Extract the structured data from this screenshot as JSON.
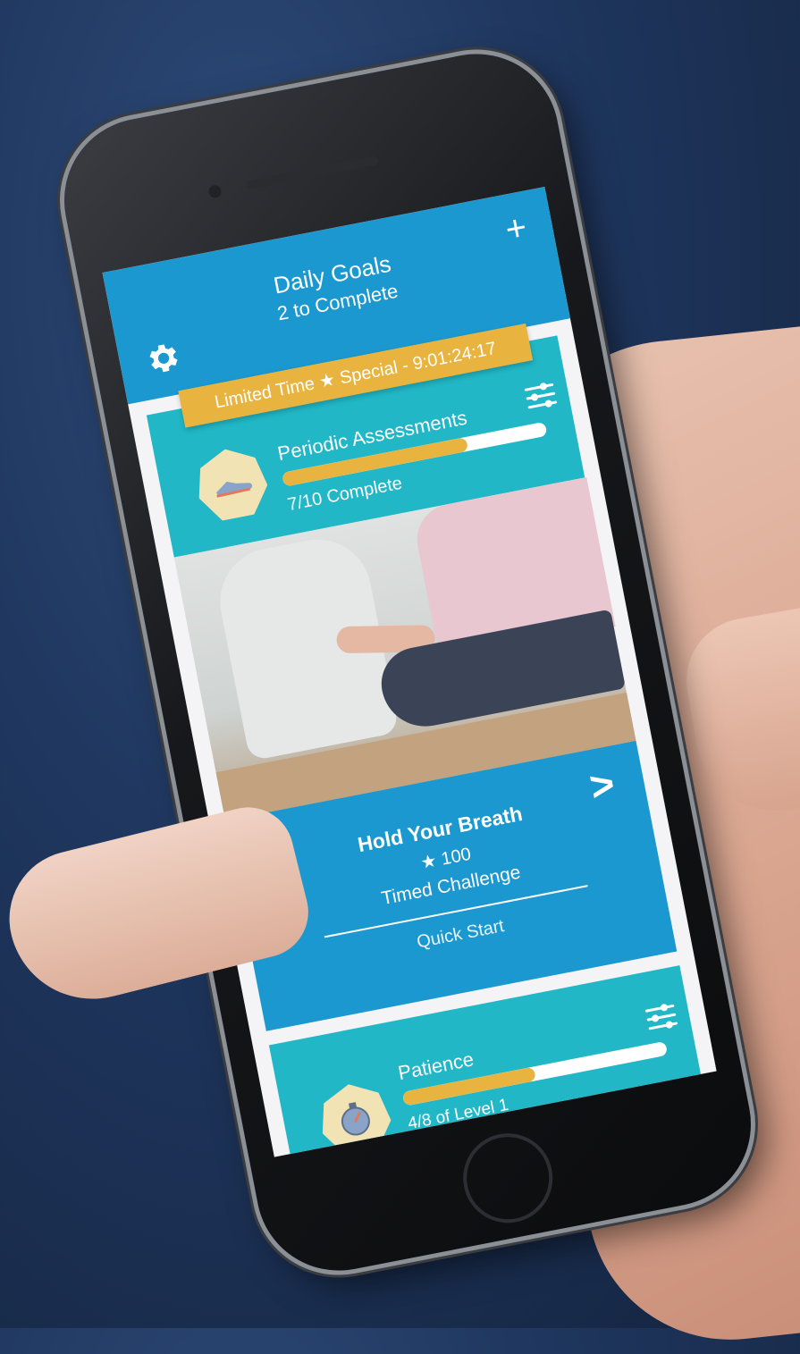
{
  "header": {
    "title": "Daily Goals",
    "subtitle": "2 to Complete",
    "settings_icon": "gear-icon",
    "add_icon": "plus-icon",
    "add_label": "+"
  },
  "promo": {
    "prefix": "Limited Time",
    "star": "★",
    "suffix": "Special - 9:01:24:17"
  },
  "goals": [
    {
      "title": "Periodic Assessments",
      "status": "7/10 Complete",
      "progress": 0.7,
      "icon": "sneaker-icon",
      "settings_icon": "sliders-icon"
    },
    {
      "title": "Patience",
      "status": "4/8 of Level 1",
      "progress": 0.5,
      "icon": "stopwatch-icon",
      "settings_icon": "sliders-icon"
    }
  ],
  "challenge": {
    "title": "Hold Your Breath",
    "points_star": "★",
    "points": "100",
    "type": "Timed Challenge",
    "action": "Quick Start",
    "prev_label": "<",
    "next_label": ">"
  },
  "colors": {
    "header_blue": "#1b98cf",
    "card_teal": "#21b7c6",
    "accent_gold": "#e8b43f"
  }
}
